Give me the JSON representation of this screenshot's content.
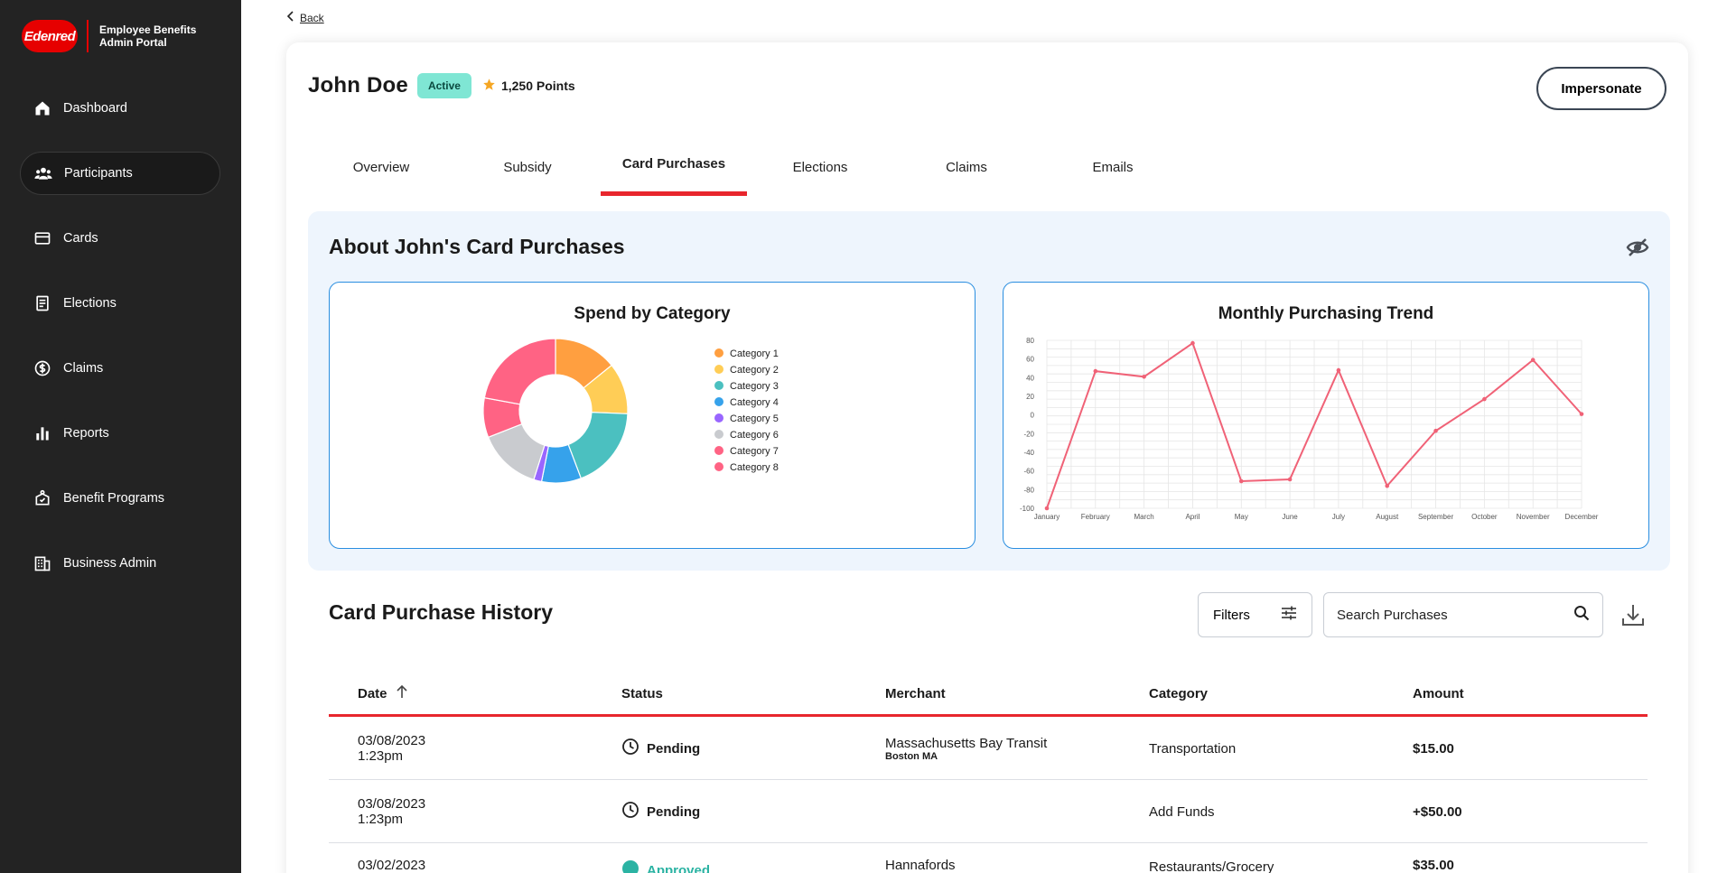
{
  "brand": {
    "logo_text": "Edenred",
    "title_line1": "Employee Benefits",
    "title_line2": "Admin Portal"
  },
  "sidebar": {
    "items": [
      {
        "label": "Dashboard",
        "icon": "home-icon"
      },
      {
        "label": "Participants",
        "icon": "people-icon",
        "active": true
      },
      {
        "label": "Cards",
        "icon": "card-icon"
      },
      {
        "label": "Elections",
        "icon": "document-icon"
      },
      {
        "label": "Claims",
        "icon": "dollar-circle-icon"
      },
      {
        "label": "Reports",
        "icon": "bar-chart-icon"
      },
      {
        "label": "Benefit Programs",
        "icon": "benefit-icon"
      },
      {
        "label": "Business Admin",
        "icon": "building-icon"
      }
    ]
  },
  "back_label": "Back",
  "participant": {
    "name": "John Doe",
    "status": "Active",
    "points": "1,250 Points"
  },
  "impersonate_label": "Impersonate",
  "tabs": [
    {
      "label": "Overview"
    },
    {
      "label": "Subsidy"
    },
    {
      "label": "Card Purchases",
      "active": true
    },
    {
      "label": "Elections"
    },
    {
      "label": "Claims"
    },
    {
      "label": "Emails"
    }
  ],
  "about": {
    "title": "About John's Card Purchases"
  },
  "colors": {
    "accent_red": "#e8262d",
    "active_badge": "#7fe6d4",
    "chart_border": "#2a8ee0",
    "line": "#f06277"
  },
  "chart_data": [
    {
      "type": "pie",
      "title": "Spend by Category",
      "donut": true,
      "categories": [
        "Category 1",
        "Category 2",
        "Category 3",
        "Category 4",
        "Category 5",
        "Category 6",
        "Category 7",
        "Category 8"
      ],
      "values": [
        16,
        13,
        21,
        10,
        2,
        16,
        10,
        25
      ],
      "colors": [
        "#ff9f40",
        "#ffcd56",
        "#4bc0c0",
        "#36a2eb",
        "#9966ff",
        "#c9cbcf",
        "#ff6384",
        "#ff6384"
      ],
      "legend_position": "right"
    },
    {
      "type": "line",
      "title": "Monthly Purchasing Trend",
      "categories": [
        "January",
        "February",
        "March",
        "April",
        "May",
        "June",
        "July",
        "August",
        "September",
        "October",
        "November",
        "December"
      ],
      "series": [
        {
          "values": [
            -100,
            47,
            41,
            77,
            -71,
            -69,
            48,
            -76,
            -17,
            17,
            59,
            1
          ]
        }
      ],
      "ylim": [
        -100,
        80
      ],
      "yticks": [
        80,
        60,
        40,
        20,
        0,
        -20,
        -40,
        -60,
        -80,
        -100
      ],
      "grid": true
    }
  ],
  "history": {
    "title": "Card Purchase History",
    "filters_label": "Filters",
    "search_placeholder": "Search Purchases",
    "columns": {
      "date": "Date",
      "status": "Status",
      "merchant": "Merchant",
      "category": "Category",
      "amount": "Amount"
    },
    "rows": [
      {
        "date": "03/08/2023",
        "time": "1:23pm",
        "status": "Pending",
        "merchant": "Massachusetts Bay Transit",
        "merchant_sub": "Boston MA",
        "category": "Transportation",
        "amount": "$15.00"
      },
      {
        "date": "03/08/2023",
        "time": "1:23pm",
        "status": "Pending",
        "merchant": "",
        "merchant_sub": "",
        "category": "Add Funds",
        "amount": "+$50.00"
      },
      {
        "date": "03/02/2023",
        "time": "",
        "status": "Approved",
        "merchant": "Hannafords",
        "merchant_sub": "",
        "category": "Restaurants/Grocery",
        "amount": "$35.00"
      }
    ]
  }
}
